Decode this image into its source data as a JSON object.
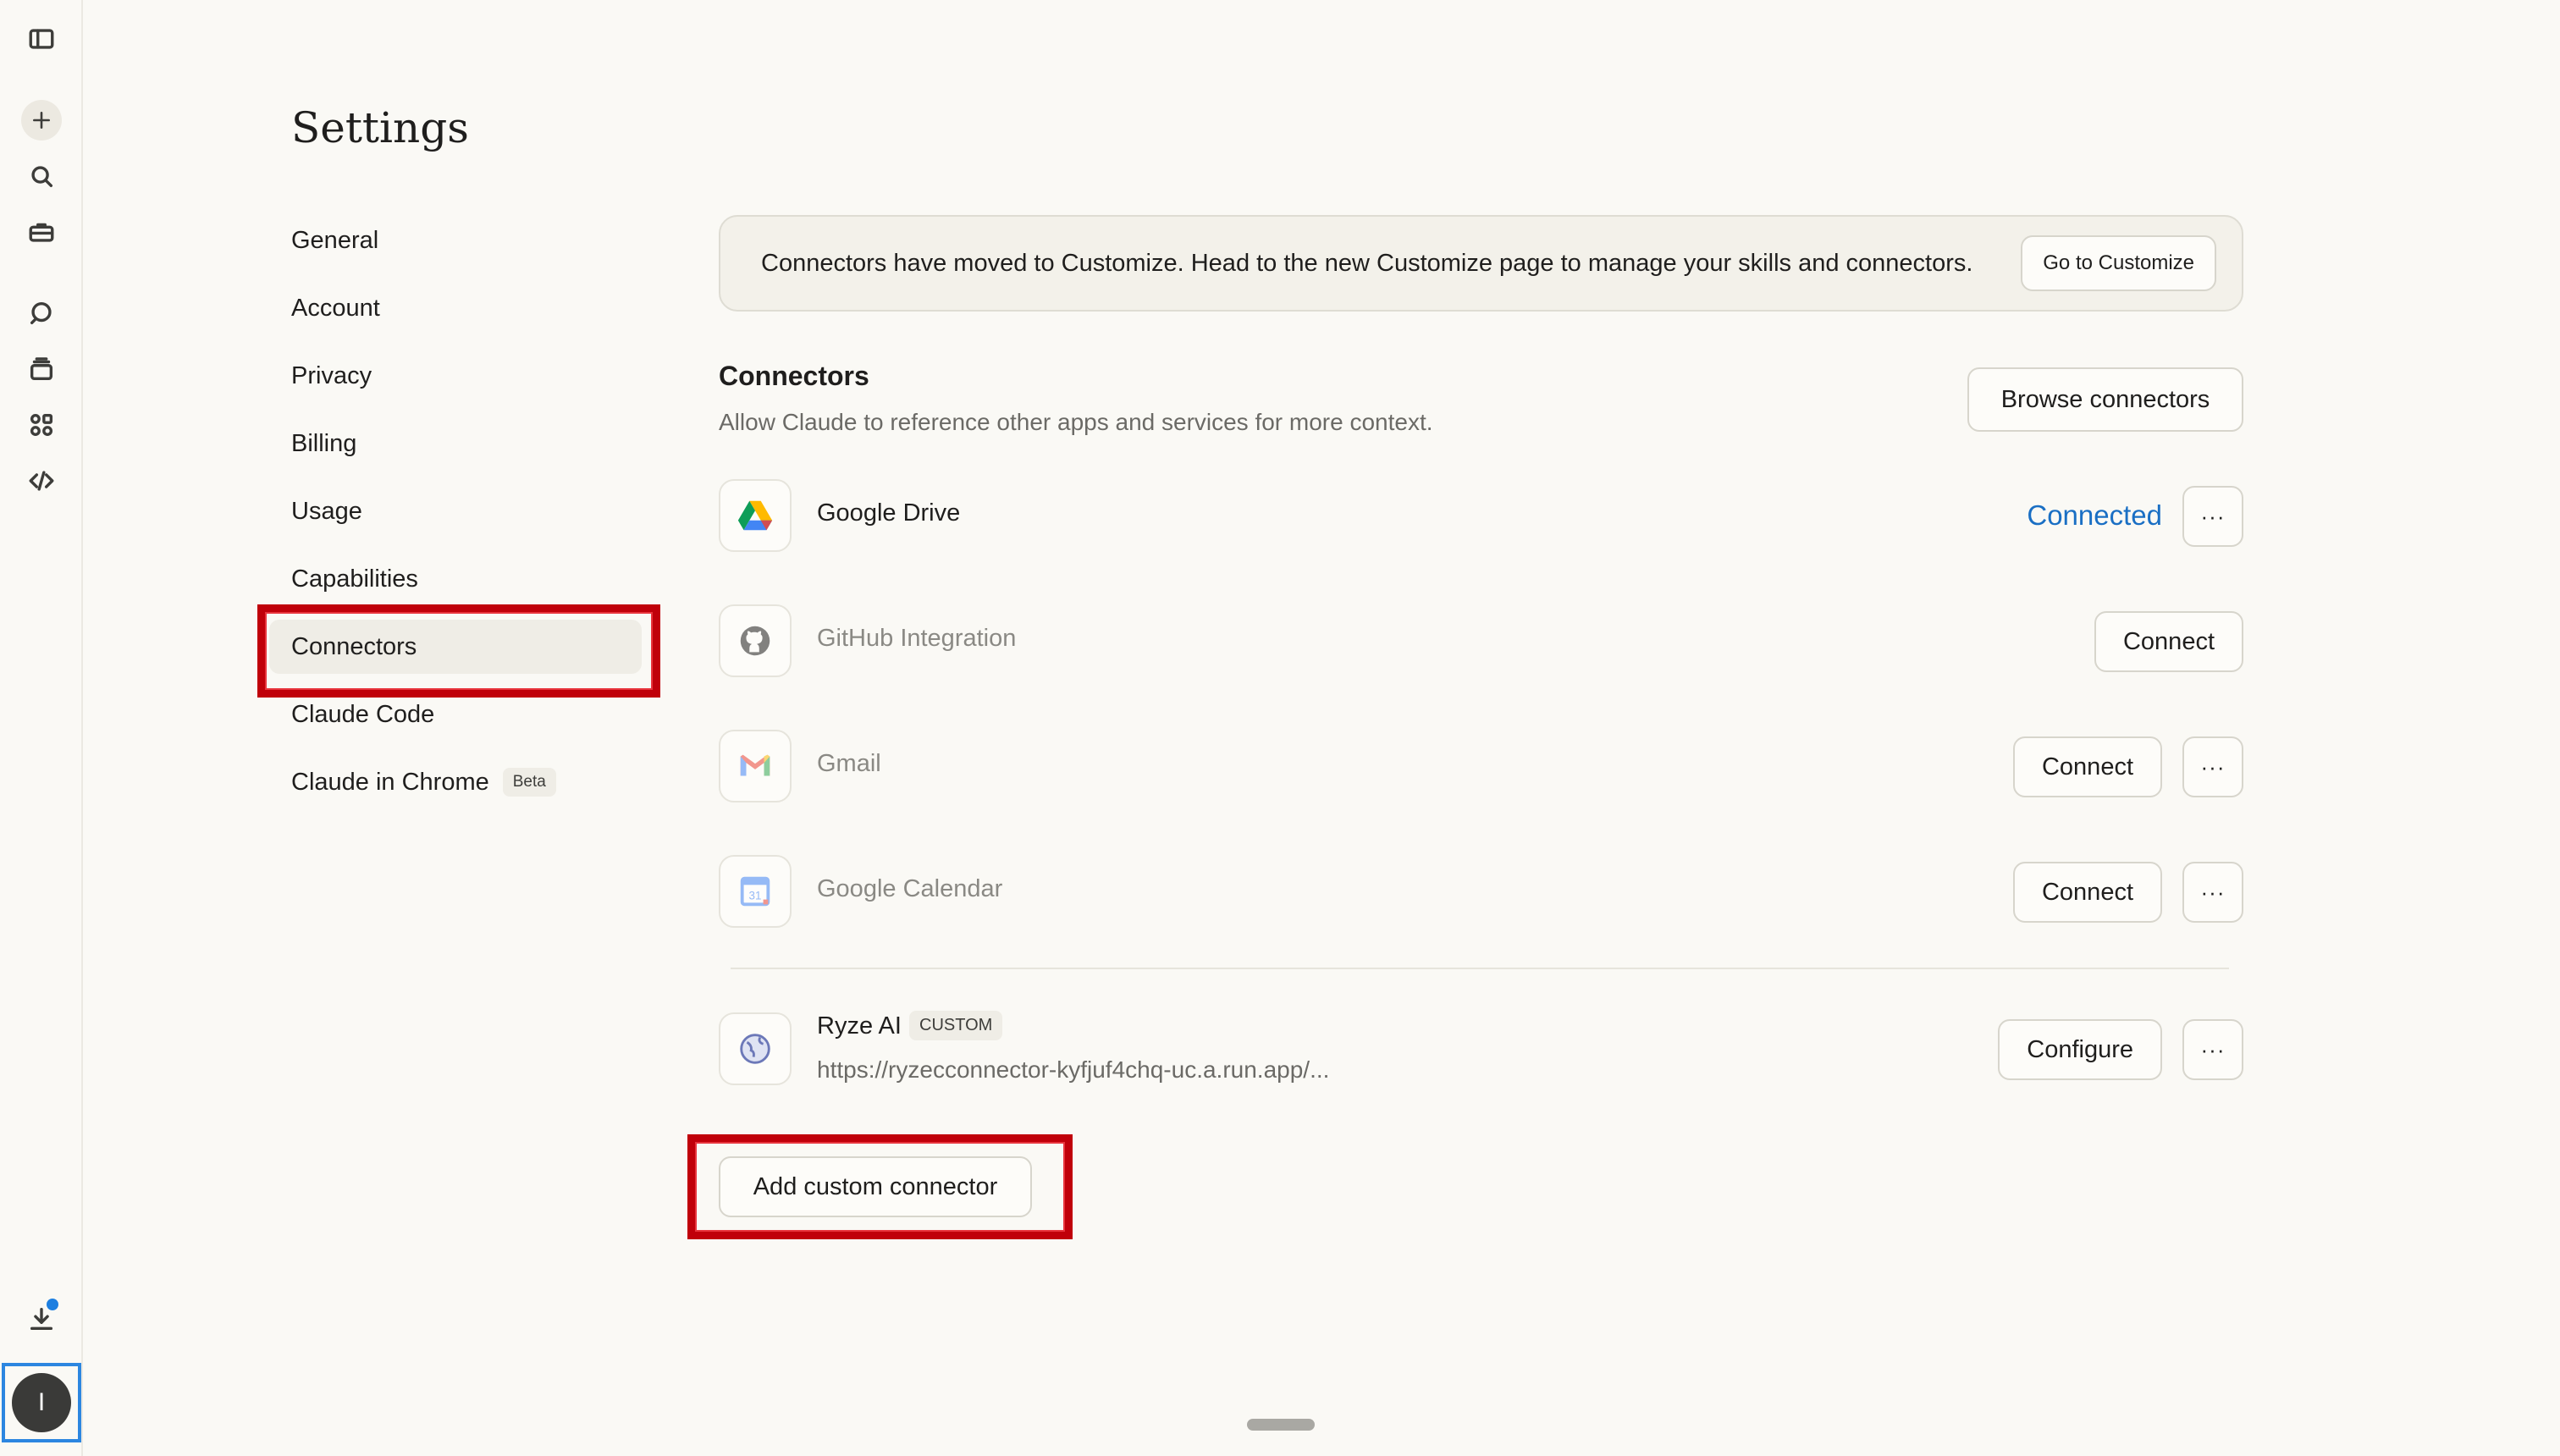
{
  "page": {
    "title": "Settings"
  },
  "nav": {
    "items": [
      {
        "label": "General"
      },
      {
        "label": "Account"
      },
      {
        "label": "Privacy"
      },
      {
        "label": "Billing"
      },
      {
        "label": "Usage"
      },
      {
        "label": "Capabilities"
      },
      {
        "label": "Connectors",
        "active": true
      },
      {
        "label": "Claude Code"
      },
      {
        "label": "Claude in Chrome",
        "badge": "Beta"
      }
    ]
  },
  "banner": {
    "text": "Connectors have moved to Customize. Head to the new Customize page to manage your skills and connectors.",
    "button_label": "Go to Customize"
  },
  "connectors": {
    "title": "Connectors",
    "subtitle": "Allow Claude to reference other apps and services for more context.",
    "browse_label": "Browse connectors",
    "items": [
      {
        "name": "Google Drive",
        "icon": "google-drive-icon",
        "status": "Connected"
      },
      {
        "name": "GitHub Integration",
        "icon": "github-icon",
        "action": "Connect"
      },
      {
        "name": "Gmail",
        "icon": "gmail-icon",
        "action": "Connect"
      },
      {
        "name": "Google Calendar",
        "icon": "google-calendar-icon",
        "action": "Connect"
      }
    ],
    "custom": {
      "name": "Ryze AI",
      "badge": "CUSTOM",
      "url": "https://ryzecconnector-kyfjuf4chq-uc.a.run.app/...",
      "action": "Configure",
      "icon": "globe-icon"
    },
    "more_label": "···",
    "add_label": "Add custom connector"
  },
  "user": {
    "initial": "I"
  },
  "colors": {
    "background": "#faf9f5",
    "link": "#1a6fc4",
    "highlight": "#c0000a",
    "notification": "#1d7fe0"
  }
}
